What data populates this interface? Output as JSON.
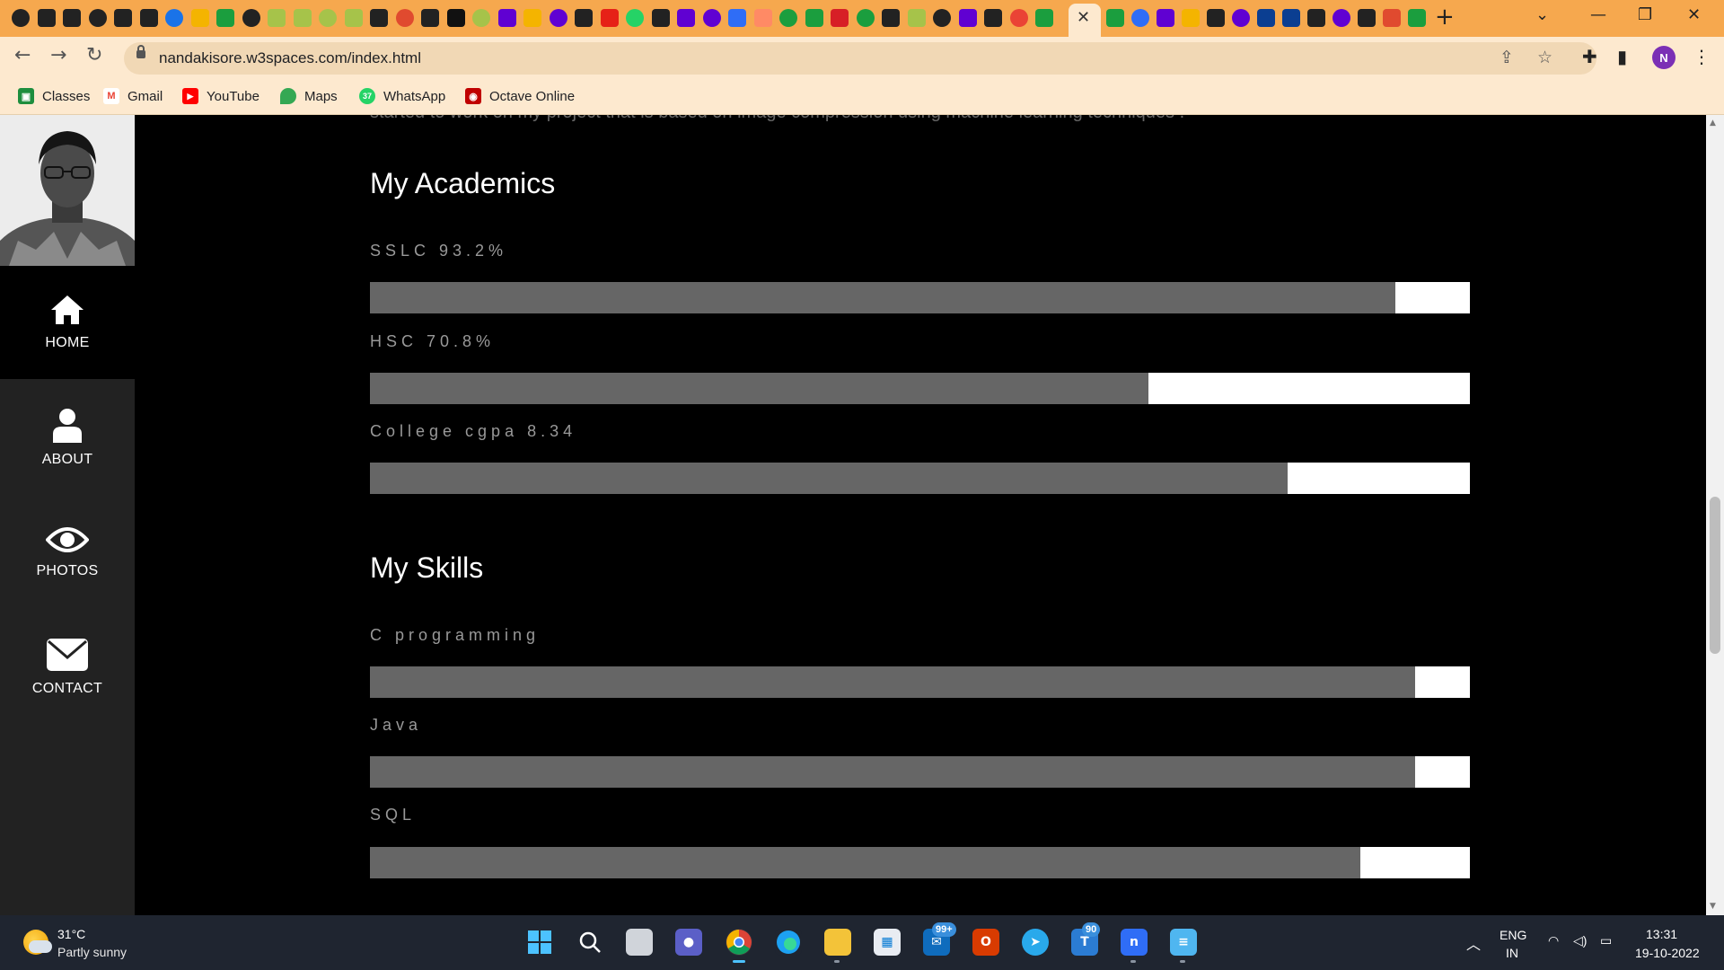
{
  "browser": {
    "url": "nandakisore.w3spaces.com/index.html",
    "profile_initial": "N",
    "tab_close_glyph": "✕",
    "new_tab_glyph": "+",
    "bookmarks": [
      {
        "label": "Classes",
        "icon": "classroom-icon",
        "color": "#1e8e3e"
      },
      {
        "label": "Gmail",
        "icon": "gmail-icon",
        "color": "#ea4335"
      },
      {
        "label": "YouTube",
        "icon": "youtube-icon",
        "color": "#ff0000"
      },
      {
        "label": "Maps",
        "icon": "maps-icon",
        "color": "#34a853"
      },
      {
        "label": "WhatsApp",
        "icon": "whatsapp-icon",
        "color": "#25d366"
      },
      {
        "label": "Octave Online",
        "icon": "octave-icon",
        "color": "#c00000"
      }
    ]
  },
  "sidebar": {
    "items": [
      {
        "label": "HOME",
        "icon": "home-icon",
        "active": true
      },
      {
        "label": "ABOUT",
        "icon": "user-icon",
        "active": false
      },
      {
        "label": "PHOTOS",
        "icon": "eye-icon",
        "active": false
      },
      {
        "label": "CONTACT",
        "icon": "envelope-icon",
        "active": false
      }
    ]
  },
  "main": {
    "clipped_text": "started to work on my project that is based on image compression using machine learning techniques .",
    "academics": {
      "title": "My Academics",
      "items": [
        {
          "label": "SSLC 93.2%",
          "fill_percent": 93.2
        },
        {
          "label": "HSC 70.8%",
          "fill_percent": 70.8
        },
        {
          "label": "College cgpa 8.34",
          "fill_percent": 83.4
        }
      ]
    },
    "skills": {
      "title": "My Skills",
      "items": [
        {
          "label": "C programming",
          "fill_percent": 95
        },
        {
          "label": "Java",
          "fill_percent": 95
        },
        {
          "label": "SQL",
          "fill_percent": 90
        }
      ]
    }
  },
  "taskbar": {
    "weather": {
      "temp": "31°C",
      "condition": "Partly sunny"
    },
    "mail_badge": "99+",
    "teams_badge": "90",
    "language": "ENG",
    "region": "IN",
    "time": "13:31",
    "date": "19-10-2022"
  },
  "colors": {
    "tabstrip": "#f6a84e",
    "toolbar": "#fde9cf",
    "sidebar": "#222222",
    "bar_fill": "#666666",
    "bar_track": "#ffffff"
  }
}
